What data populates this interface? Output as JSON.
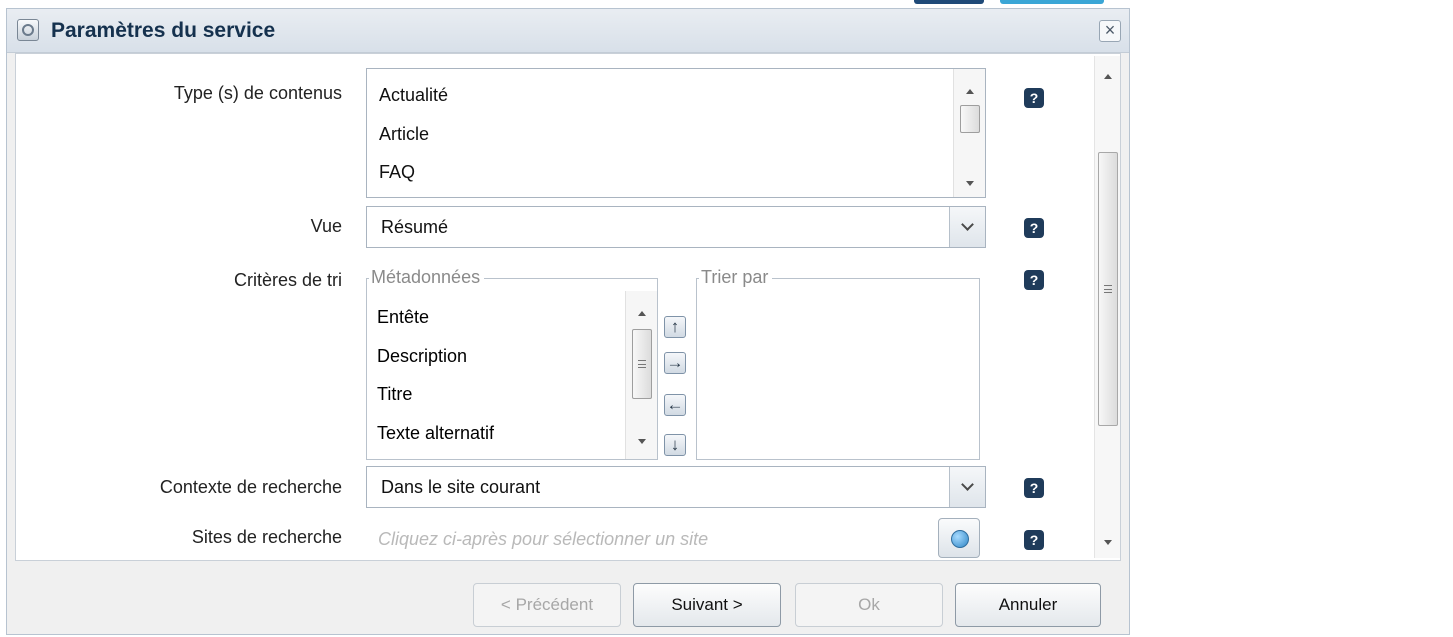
{
  "dialog": {
    "title": "Paramètres du service",
    "close_glyph": "×"
  },
  "fields": {
    "content_types": {
      "label": "Type (s) de contenus",
      "items": [
        "Actualité",
        "Article",
        "FAQ"
      ]
    },
    "view": {
      "label": "Vue",
      "value": "Résumé"
    },
    "sort": {
      "label": "Critères de tri",
      "metadata_legend": "Métadonnées",
      "metadata_items": [
        "Entête",
        "Description",
        "Titre",
        "Texte alternatif"
      ],
      "sort_by_legend": "Trier par",
      "sort_by_items": []
    },
    "search_context": {
      "label": "Contexte de recherche",
      "value": "Dans le site courant"
    },
    "search_sites": {
      "label": "Sites de recherche",
      "placeholder": "Cliquez ci-après pour sélectionner un site"
    }
  },
  "help_glyph": "?",
  "footer": {
    "previous": "< Précédent",
    "next": "Suivant >",
    "ok": "Ok",
    "cancel": "Annuler"
  },
  "colors": {
    "title": "#15314e",
    "help_badge": "#1f3b5a",
    "disabled_text": "#a7a7a7",
    "placeholder": "#b9b9b9"
  },
  "icons": {
    "title": "service-icon",
    "close": "close-icon",
    "help": "help-icon",
    "site_picker": "globe-icon",
    "move_up": "arrow-up-icon",
    "move_right": "arrow-right-icon",
    "move_left": "arrow-left-icon",
    "move_down": "arrow-down-icon"
  }
}
